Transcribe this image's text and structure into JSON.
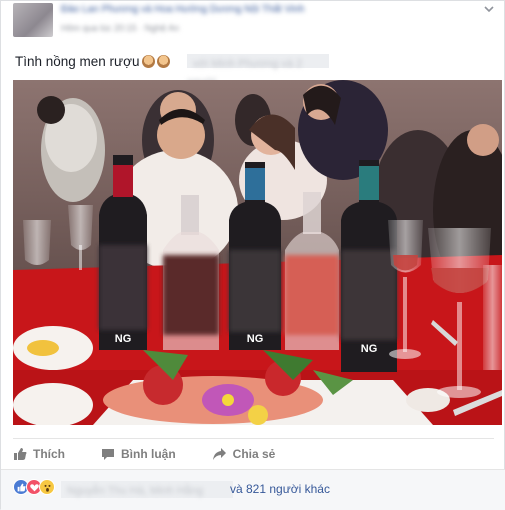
{
  "post": {
    "author_blurred": "Đào Lan Phương và Hoa Hướng Dương Nội Thất Vinh",
    "meta_blurred": "Hôm qua lúc 20:15 · Nghệ An",
    "caption": "Tình nồng men rượu",
    "tagged_blurred": "với Minh Phương và 2 người"
  },
  "photo": {
    "label_text": "NG",
    "colors": {
      "tablecloth": "#c8161a",
      "bottle": "#1f1c20",
      "label_red": "#b0152a",
      "label_blue": "#2e6f9a",
      "label_teal": "#2a7c7d",
      "wine": "#c3443f"
    }
  },
  "actions": {
    "like": "Thích",
    "comment": "Bình luận",
    "share": "Chia sẻ"
  },
  "reactions": {
    "types": [
      "like-icon",
      "love-icon",
      "wow-icon"
    ],
    "names_blurred": "Nguyễn Thu Hà, Minh Hằng",
    "others": "và 821 người khác"
  },
  "theme": {
    "link": "#365899",
    "action": "#7f7f7f",
    "footer_bg": "#f6f7f9"
  }
}
